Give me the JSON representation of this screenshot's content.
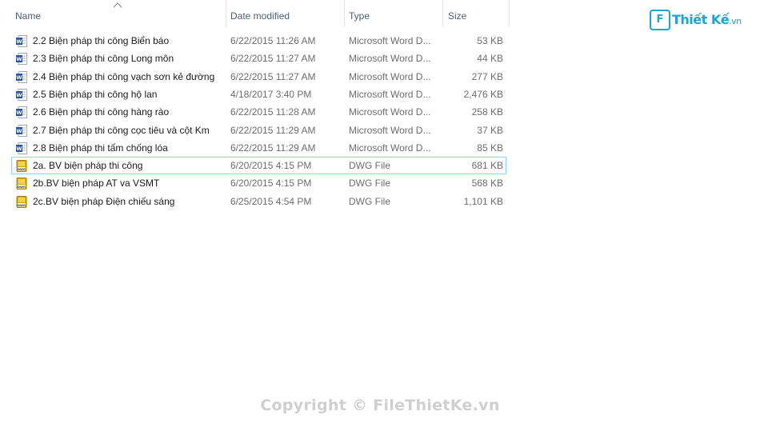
{
  "columns": {
    "name": "Name",
    "date_modified": "Date modified",
    "type": "Type",
    "size": "Size"
  },
  "files": [
    {
      "name": "2.2 Biện pháp thi công Biển báo",
      "date": "6/22/2015 11:26 AM",
      "type": "Microsoft Word D...",
      "size": "53 KB",
      "icon": "word-doc-icon"
    },
    {
      "name": "2.3 Biện pháp thi công Long môn",
      "date": "6/22/2015 11:27 AM",
      "type": "Microsoft Word D...",
      "size": "44 KB",
      "icon": "word-doc-icon"
    },
    {
      "name": "2.4 Biện pháp thi công vạch sơn kẻ đường",
      "date": "6/22/2015 11:27 AM",
      "type": "Microsoft Word D...",
      "size": "277 KB",
      "icon": "word-doc-icon"
    },
    {
      "name": "2.5 Biện pháp thi công hộ lan",
      "date": "4/18/2017 3:40 PM",
      "type": "Microsoft Word D...",
      "size": "2,476 KB",
      "icon": "word-doc-icon"
    },
    {
      "name": "2.6 Biện pháp thi công hàng rào",
      "date": "6/22/2015 11:28 AM",
      "type": "Microsoft Word D...",
      "size": "258 KB",
      "icon": "word-doc-icon"
    },
    {
      "name": "2.7 Biện pháp thi công cọc tiêu và cột Km",
      "date": "6/22/2015 11:29 AM",
      "type": "Microsoft Word D...",
      "size": "37 KB",
      "icon": "word-doc-icon"
    },
    {
      "name": "2.8 Biện pháp thi tấm chống lóa",
      "date": "6/22/2015 11:29 AM",
      "type": "Microsoft Word D...",
      "size": "85 KB",
      "icon": "word-doc-icon"
    },
    {
      "name": "2a. BV biện pháp thi công",
      "date": "6/20/2015 4:15 PM",
      "type": "DWG File",
      "size": "681 KB",
      "icon": "dwg-file-icon",
      "selected": true
    },
    {
      "name": "2b.BV biện pháp AT va VSMT",
      "date": "6/20/2015 4:15 PM",
      "type": "DWG File",
      "size": "568 KB",
      "icon": "dwg-file-icon"
    },
    {
      "name": "2c.BV biện pháp Điện chiếu sáng",
      "date": "6/25/2015 4:54 PM",
      "type": "DWG File",
      "size": "1,101 KB",
      "icon": "dwg-file-icon"
    }
  ],
  "logo": {
    "mark": "File",
    "name": "Thiết Kế",
    "ext": ".vn"
  },
  "watermark": "Copyright © FileThietKe.vn",
  "colors": {
    "accent": "#1fa3d6",
    "selection_border": "#99d1ff",
    "header_text": "#4c607a"
  }
}
